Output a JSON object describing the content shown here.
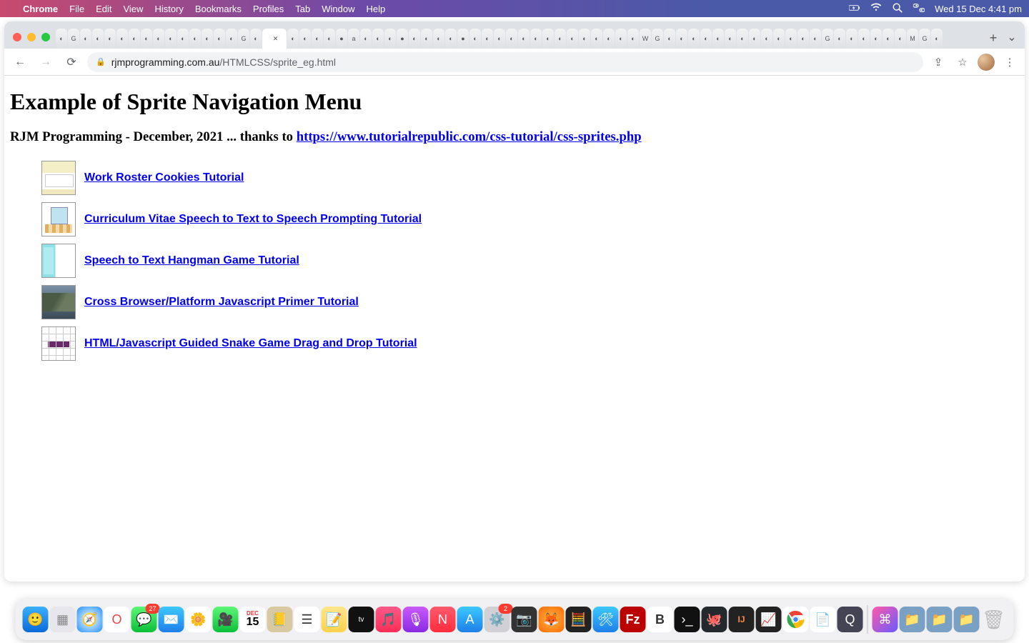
{
  "menubar": {
    "app": "Chrome",
    "items": [
      "File",
      "Edit",
      "View",
      "History",
      "Bookmarks",
      "Profiles",
      "Tab",
      "Window",
      "Help"
    ],
    "clock": "Wed 15 Dec  4:41 pm"
  },
  "browser": {
    "url_domain": "rjmprogramming.com.au",
    "url_path": "/HTMLCSS/sprite_eg.html"
  },
  "page": {
    "title": "Example of Sprite Navigation Menu",
    "subtitle_prefix": "RJM Programming - December, 2021 ... thanks to ",
    "subtitle_link": "https://www.tutorialrepublic.com/css-tutorial/css-sprites.php",
    "items": [
      {
        "label": "Work Roster Cookies Tutorial"
      },
      {
        "label": "Curriculum Vitae Speech to Text to Speech Prompting Tutorial"
      },
      {
        "label": "Speech to Text Hangman Game Tutorial"
      },
      {
        "label": "Cross Browser/Platform Javascript Primer Tutorial"
      },
      {
        "label": "HTML/Javascript Guided Snake Game Drag and Drop Tutorial"
      }
    ]
  },
  "dock": {
    "messages_badge": "27",
    "calendar_day": "15",
    "calendar_month": "DEC"
  }
}
